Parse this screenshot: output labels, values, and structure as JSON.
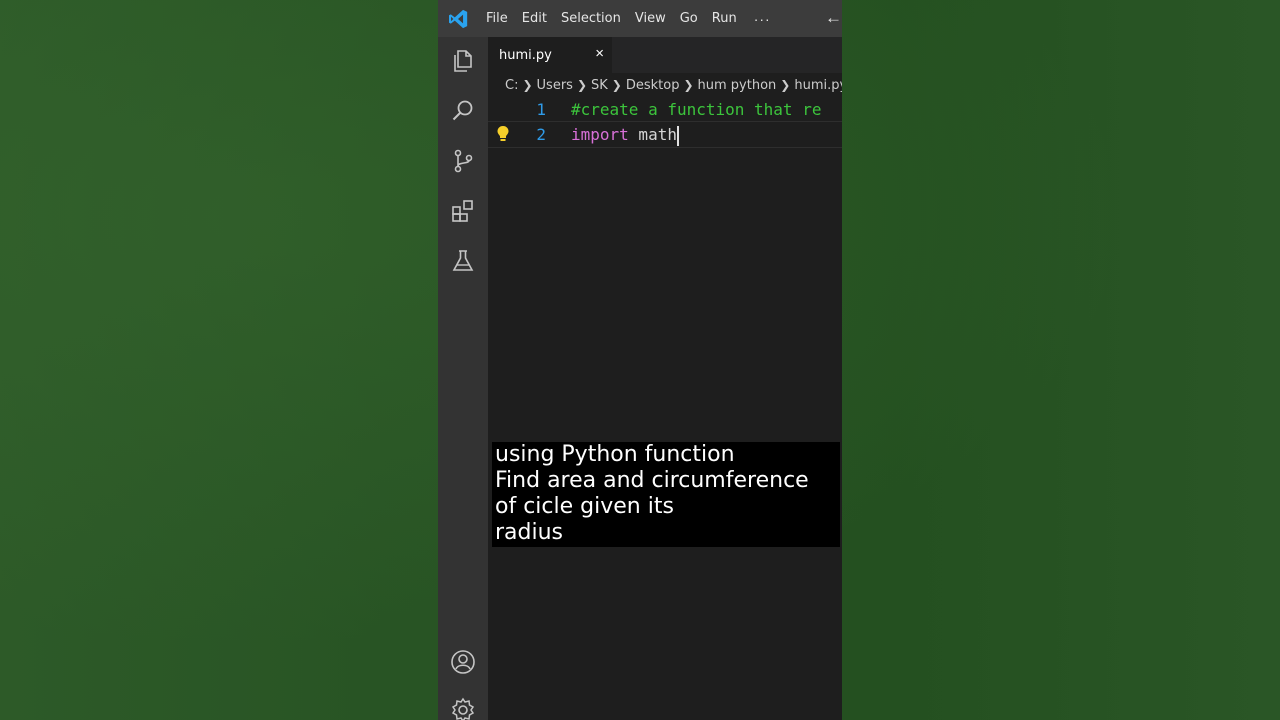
{
  "window": {
    "menu": [
      "File",
      "Edit",
      "Selection",
      "View",
      "Go",
      "Run"
    ],
    "more": "···",
    "back": "←"
  },
  "activity_bar": {
    "icons": [
      "explorer-icon",
      "search-icon",
      "source-control-icon",
      "extensions-icon",
      "testing-icon",
      "account-icon",
      "settings-gear-icon"
    ]
  },
  "editor": {
    "tab": {
      "label": "humi.py",
      "close": "×"
    },
    "breadcrumb": [
      "C:",
      "Users",
      "SK",
      "Desktop",
      "hum python",
      "humi.py"
    ],
    "lines": [
      {
        "number": "1",
        "text": "#create a function that re"
      },
      {
        "number": "2",
        "keyword": "import",
        "rest": " math"
      }
    ]
  },
  "caption": {
    "lines": [
      "using Python function",
      "Find area and circumference",
      "of cicle given its",
      "radius"
    ]
  },
  "colors": {
    "background": "#2a5626",
    "editor_bg": "#1e1e1e",
    "titlebar": "#3c3c3c",
    "activitybar": "#333333",
    "line_numbers": "#2f9be8",
    "comment": "#3cc43c",
    "keyword": "#d770d7"
  }
}
